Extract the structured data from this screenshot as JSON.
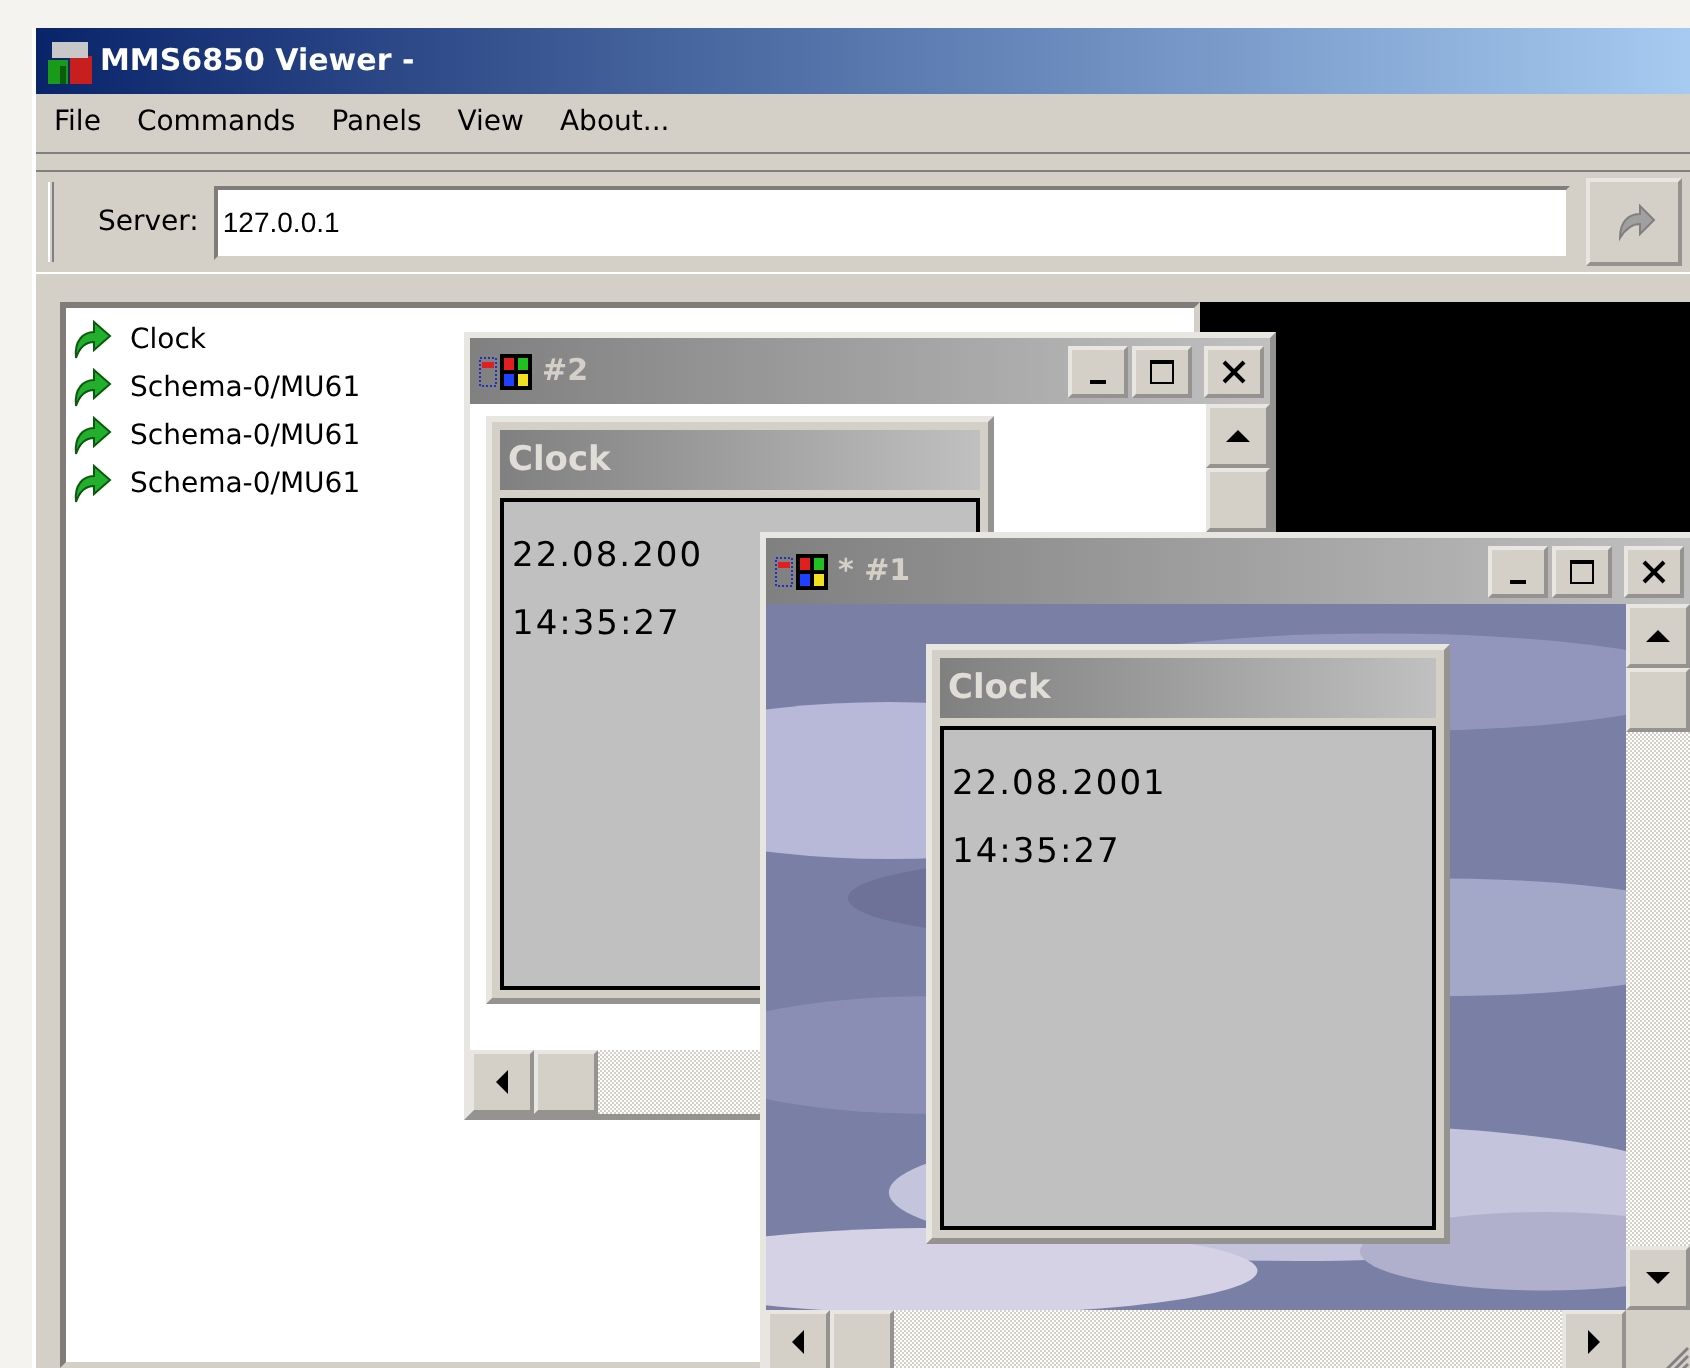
{
  "window": {
    "title": "MMS6850 Viewer -",
    "active": true
  },
  "menu": [
    {
      "label": "File"
    },
    {
      "label": "Commands"
    },
    {
      "label": "Panels"
    },
    {
      "label": "View"
    },
    {
      "label": "About..."
    }
  ],
  "toolbar": {
    "server_label": "Server:",
    "server_value": "127.0.0.1"
  },
  "sidebar": {
    "items": [
      {
        "label": "Clock"
      },
      {
        "label": "Schema-0/MU61"
      },
      {
        "label": "Schema-0/MU61"
      },
      {
        "label": "Schema-0/MU61"
      }
    ]
  },
  "child_windows": [
    {
      "title": "#2",
      "active": false,
      "kind": "plain",
      "panel": {
        "title": "Clock",
        "lines": [
          "22.08.200",
          "14:35:27"
        ]
      }
    },
    {
      "title": "* #1",
      "active": false,
      "kind": "picture",
      "panel": {
        "title": "Clock",
        "lines": [
          "22.08.2001",
          "14:35:27"
        ]
      }
    }
  ]
}
